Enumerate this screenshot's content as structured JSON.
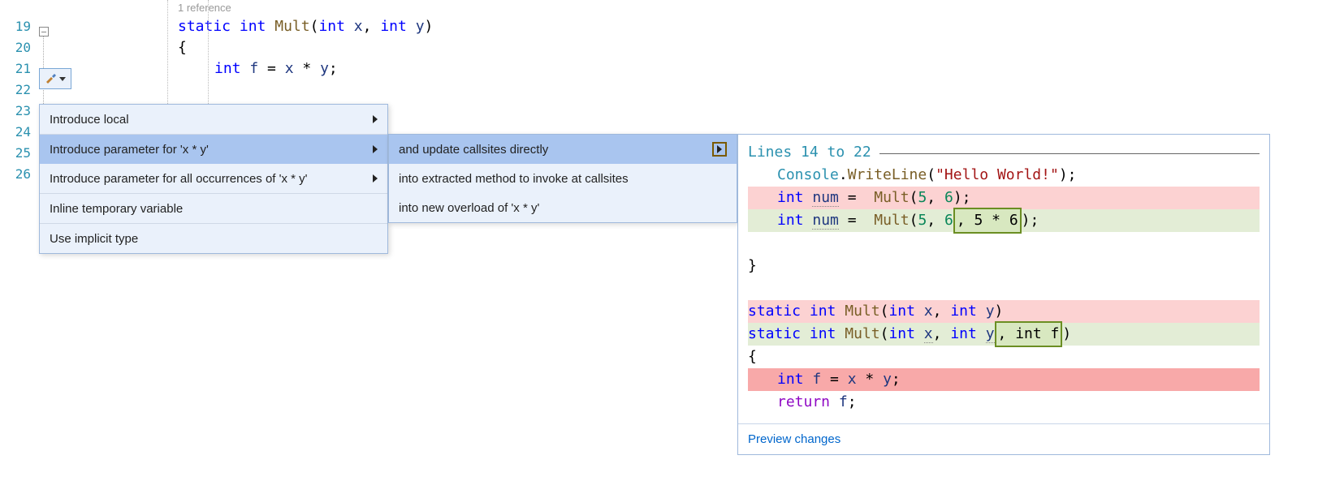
{
  "gutter": {
    "l19": "19",
    "l20": "20",
    "l21": "21",
    "l22": "22",
    "l23": "23",
    "l24": "24",
    "l25": "25",
    "l26": "26"
  },
  "codelens": {
    "refs": "1 reference"
  },
  "code": {
    "l19": {
      "static": "static",
      "int": "int",
      "mult": "Mult",
      "open": "(",
      "int1": "int",
      "x": "x",
      "comma": ",",
      "int2": "int",
      "y": "y",
      "close": ")"
    },
    "l20": {
      "brace": "{"
    },
    "l21": {
      "int": "int",
      "f": "f",
      "eq": " = ",
      "x": "x",
      "star": " * ",
      "y": "y",
      "semi": ";"
    }
  },
  "menu1": {
    "i0": "Introduce local",
    "i1": "Introduce parameter for 'x * y'",
    "i2": "Introduce parameter for all occurrences of 'x * y'",
    "i3": "Inline temporary variable",
    "i4": "Use implicit type"
  },
  "menu2": {
    "i0": "and update callsites directly",
    "i1": "into extracted method to invoke at callsites",
    "i2": "into new overload of 'x * y'"
  },
  "preview": {
    "title": "Lines 14 to 22",
    "line_cw": {
      "console": "Console",
      "dot": ".",
      "wl": "WriteLine",
      "op": "(",
      "str": "\"Hello World!\"",
      "cl": ")",
      "semi": ";"
    },
    "line_old": {
      "int": "int",
      "num": "num",
      "eq": " =  ",
      "mult": "Mult",
      "op": "(",
      "a": "5",
      "c": ", ",
      "b": "6",
      "cl": ")",
      "semi": ";"
    },
    "line_new": {
      "int": "int",
      "num": "num",
      "eq": " =  ",
      "mult": "Mult",
      "op": "(",
      "a": "5",
      "c": ", ",
      "b": "6",
      "hl": ", 5 * 6",
      "cl": ")",
      "semi": ";"
    },
    "line_brace_close": "}",
    "sig_old": {
      "static": "static",
      "int": "int",
      "mult": "Mult",
      "op": "(",
      "int1": "int",
      "x": "x",
      "c": ", ",
      "int2": "int",
      "y": "y",
      "cl": ")"
    },
    "sig_new": {
      "static": "static",
      "int": "int",
      "mult": "Mult",
      "op": "(",
      "int1": "int",
      "x": "x",
      "c1": ", ",
      "int2": "int",
      "y": "y",
      "hl": ", int f",
      "cl": ")"
    },
    "line_brace_open": "{",
    "line_del_body": {
      "int": "int",
      "f": "f",
      "eq": " = ",
      "x": "x",
      "star": " * ",
      "y": "y",
      "semi": ";"
    },
    "line_ret": {
      "ret": "return",
      "sp": " ",
      "f": "f",
      "semi": ";"
    },
    "footer": "Preview changes"
  }
}
